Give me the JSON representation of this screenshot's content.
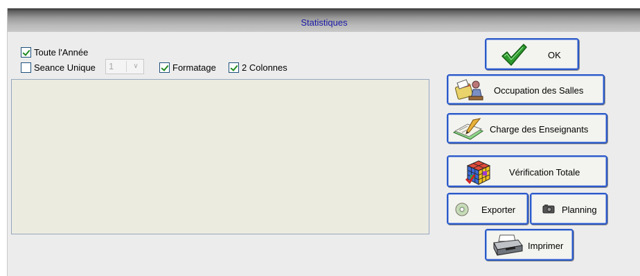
{
  "window": {
    "title": "Statistiques"
  },
  "options": {
    "toute_annee": {
      "label": "Toute l'Année",
      "checked": true
    },
    "seance_unique": {
      "label": "Seance Unique",
      "checked": false,
      "value": "1"
    },
    "formatage": {
      "label": "Formatage",
      "checked": true
    },
    "deux_colonnes": {
      "label": "2 Colonnes",
      "checked": true
    }
  },
  "output": {
    "text": ""
  },
  "buttons": {
    "ok": "OK",
    "occupation": "Occupation des Salles",
    "charge": "Charge des Enseignants",
    "verification": "Vérification Totale",
    "exporter": "Exporter",
    "planning": "Planning",
    "imprimer": "Imprimer"
  },
  "icons": {
    "ok": "checkmark-icon",
    "occupation": "classroom-icon",
    "charge": "teacher-book-icon",
    "verification": "rubiks-cube-icon",
    "exporter": "cd-disc-icon",
    "planning": "camera-icon",
    "imprimer": "printer-icon"
  },
  "colors": {
    "title_text": "#1a1aa6",
    "button_border": "#2b59c9",
    "memo_bg": "#ecebe0",
    "window_bg": "#ececec"
  }
}
